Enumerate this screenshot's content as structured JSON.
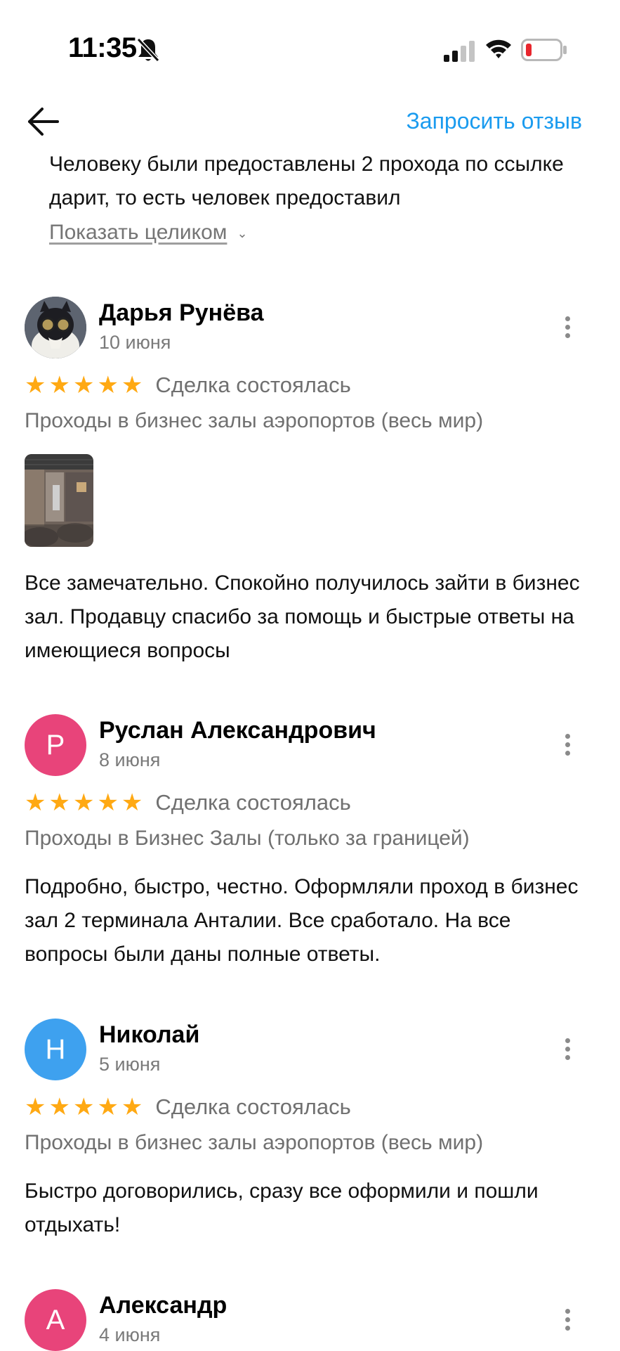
{
  "status_bar": {
    "time": "11:35"
  },
  "header": {
    "request_review_label": "Запросить отзыв"
  },
  "previous_review": {
    "text": "Человеку были предоставлены 2 прохода по ссылке дарит, то есть человек предоставил",
    "show_full_label": "Показать целиком"
  },
  "reviews": [
    {
      "author": "Дарья Рунёва",
      "date": "10 июня",
      "avatar_initial": "",
      "stars": "★★★★★",
      "rating": 5,
      "deal_status": "Сделка состоялась",
      "category": "Проходы в бизнес залы аэропортов (весь мир)",
      "text": "Все замечательно. Спокойно получилось зайти в бизнес зал. Продавцу спасибо за помощь и быстрые ответы на имеющиеся вопросы"
    },
    {
      "author": "Руслан Александрович",
      "date": "8 июня",
      "avatar_initial": "Р",
      "avatar_color": "#e8447a",
      "stars": "★★★★★",
      "rating": 5,
      "deal_status": "Сделка состоялась",
      "category": "Проходы в Бизнес Залы (только за границей)",
      "text": "Подробно, быстро, честно. Оформляли проход в бизнес зал 2 терминала Анталии. Все сработало. На все вопросы были даны полные ответы."
    },
    {
      "author": "Николай",
      "date": "5 июня",
      "avatar_initial": "Н",
      "avatar_color": "#3ea1ef",
      "stars": "★★★★★",
      "rating": 5,
      "deal_status": "Сделка состоялась",
      "category": "Проходы в бизнес залы аэропортов (весь мир)",
      "text": "Быстро договорились, сразу все оформили и пошли отдыхать!"
    },
    {
      "author": "Александр",
      "date": "4 июня",
      "avatar_initial": "А",
      "avatar_color": "#e8447a"
    }
  ],
  "colors": {
    "accent_link": "#1a9bef",
    "star": "#ffa913",
    "secondary_text": "#707070"
  }
}
